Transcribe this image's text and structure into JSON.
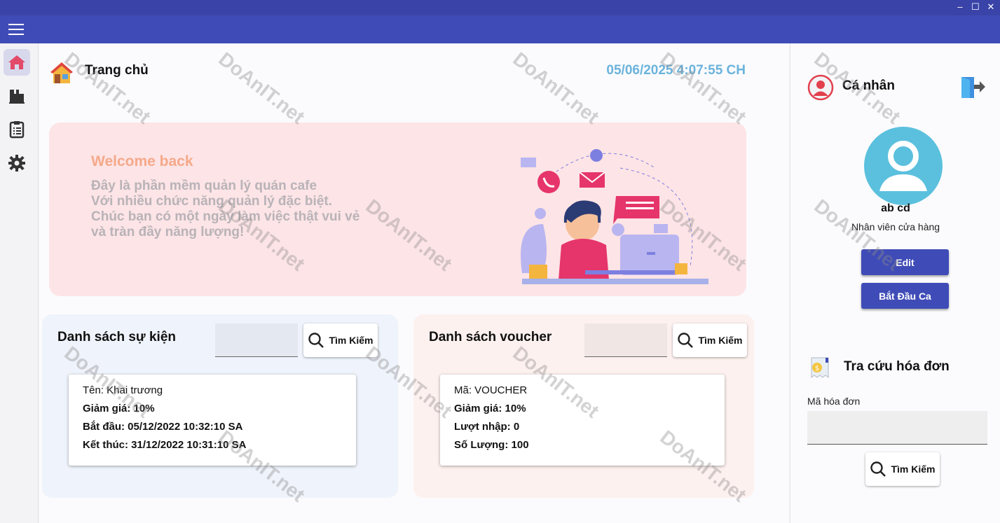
{
  "window": {
    "minimize": "–",
    "maximize": "☐",
    "close": "✕"
  },
  "nav": {
    "items": [
      {
        "icon": "home-icon"
      },
      {
        "icon": "coffee-machine-icon"
      },
      {
        "icon": "clipboard-icon"
      },
      {
        "icon": "gear-icon"
      }
    ]
  },
  "header": {
    "title": "Trang chủ",
    "datetime": "05/06/2025 4:07:55 CH"
  },
  "welcome": {
    "title": "Welcome back",
    "lines": [
      "Đây là phần mềm quản lý quán cafe",
      "Với nhiều chức năng quản lý đặc biệt.",
      "Chúc bạn có một ngày làm việc thật vui vẻ",
      "và tràn đầy năng lượng!"
    ]
  },
  "events": {
    "title": "Danh sách sự kiện",
    "search_value": "",
    "search_button": "Tìm Kiếm",
    "card": {
      "name": "Tên: Khai trương",
      "discount": "Giảm giá: 10%",
      "start": "Bắt đầu: 05/12/2022 10:32:10 SA",
      "end": "Kết thúc: 31/12/2022 10:31:10 SA"
    }
  },
  "vouchers": {
    "title": "Danh sách voucher",
    "search_value": "",
    "search_button": "Tìm Kiếm",
    "card": {
      "code": "Mã: VOUCHER",
      "discount": "Giảm giá: 10%",
      "used": "Lượt nhập: 0",
      "quantity": "Số Lượng: 100"
    }
  },
  "profile": {
    "title": "Cá nhân",
    "name": "ab cd",
    "role": "Nhân viên cửa hàng",
    "edit_button": "Edit",
    "start_shift_button": "Bắt Đầu Ca"
  },
  "invoice": {
    "title": "Tra cứu hóa đơn",
    "label": "Mã hóa đơn",
    "value": "",
    "search_button": "Tìm Kiếm"
  },
  "watermark": {
    "text": "DoAnIT.net"
  },
  "colors": {
    "accent": "#3f4cb7",
    "clock": "#6bb3dc",
    "welcome_bg": "#fde4e6",
    "avatar": "#5bc0de"
  }
}
